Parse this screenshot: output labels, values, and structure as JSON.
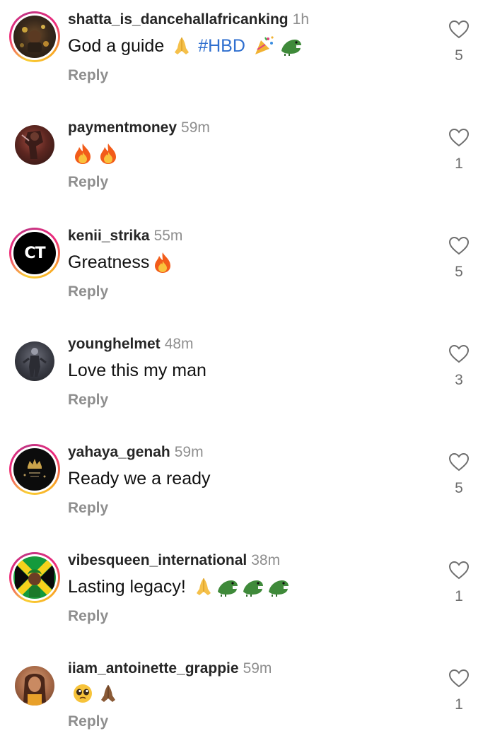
{
  "comments": [
    {
      "username": "shatta_is_dancehallafricanking",
      "time": "1h",
      "text": "God a guide",
      "hashtag": "#HBD",
      "emojis": [
        "folded-hands-icon",
        "party-popper-icon",
        "crocodile-icon"
      ],
      "reply": "Reply",
      "likes": "5",
      "story": true
    },
    {
      "username": "paymentmoney",
      "time": "59m",
      "text": "",
      "emojis": [
        "fire-icon",
        "fire-icon"
      ],
      "reply": "Reply",
      "likes": "1",
      "story": false
    },
    {
      "username": "kenii_strika",
      "time": "55m",
      "text": "Greatness",
      "emojis": [
        "fire-icon"
      ],
      "reply": "Reply",
      "likes": "5",
      "story": true
    },
    {
      "username": "younghelmet",
      "time": "48m",
      "text": "Love this my man",
      "emojis": [],
      "reply": "Reply",
      "likes": "3",
      "story": false
    },
    {
      "username": "yahaya_genah",
      "time": "59m",
      "text": "Ready we a ready",
      "emojis": [],
      "reply": "Reply",
      "likes": "5",
      "story": true
    },
    {
      "username": "vibesqueen_international",
      "time": "38m",
      "text": "Lasting legacy!",
      "emojis": [
        "folded-hands-icon",
        "crocodile-icon",
        "crocodile-icon",
        "crocodile-icon"
      ],
      "reply": "Reply",
      "likes": "1",
      "story": true
    },
    {
      "username": "iiam_antoinette_grappie",
      "time": "59m",
      "text": "",
      "emojis": [
        "pleading-face-icon",
        "folded-hands-dark-icon"
      ],
      "reply": "Reply",
      "likes": "1",
      "story": false
    }
  ],
  "avatar_logo_text": "CT",
  "colors": {
    "hashtag": "#2f6fcf",
    "muted": "#8e8e8e",
    "story_ring": [
      "#f9ce34",
      "#ee2a7b",
      "#c13584"
    ]
  }
}
